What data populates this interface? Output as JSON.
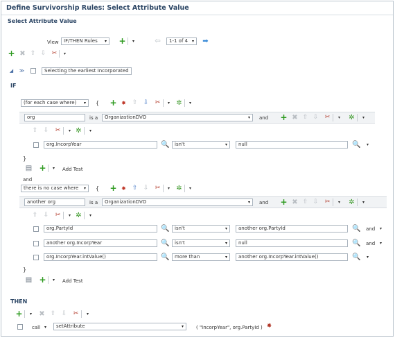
{
  "header": {
    "title": "Define Survivorship Rules: Select Attribute Value",
    "subtitle": "Select Attribute Value"
  },
  "toolbar": {
    "view_label": "View",
    "view_select": "IF/THEN Rules",
    "pager": "1-1 of 4"
  },
  "rule": {
    "name": "Selecting the earliest Incorporated"
  },
  "if_label": "IF",
  "then_label": "THEN",
  "block1": {
    "case": "(for each case where)",
    "brace": "{",
    "var": "org",
    "is_a": "is a",
    "type": "OrganizationDVO",
    "and": "and",
    "cond": {
      "field": "org.IncorpYear",
      "op": "isn't",
      "value": "null"
    },
    "close": "}",
    "add_test": "Add Test"
  },
  "and_join": "and",
  "block2": {
    "case": "there is no case where",
    "brace": "{",
    "var": "another org",
    "is_a": "is a",
    "type": "OrganizationDVO",
    "and": "and",
    "conds": [
      {
        "field": "org.PartyId",
        "op": "isn't",
        "value": "another org.PartyId",
        "join": "and"
      },
      {
        "field": "another org.IncorpYear",
        "op": "isn't",
        "value": "null",
        "join": "and"
      },
      {
        "field": "org.IncorpYear.intValue()",
        "op": "more than",
        "value": "another org.IncorpYear.intValue()",
        "join": ""
      }
    ],
    "close": "}",
    "add_test": "Add Test"
  },
  "then": {
    "action": "call",
    "method": "setAttribute",
    "args": "( \"IncorpYear\", org.PartyId )"
  },
  "icons": {
    "plus": "+",
    "delete": "✖",
    "up": "⇧",
    "down": "⇩",
    "cut": "✂",
    "gear": "✲",
    "chevron": "▾",
    "search": "🔍",
    "prev": "⇦",
    "next": "➡",
    "collapse": "◢",
    "expand": "≫",
    "copy": "▤",
    "red": "✸"
  }
}
